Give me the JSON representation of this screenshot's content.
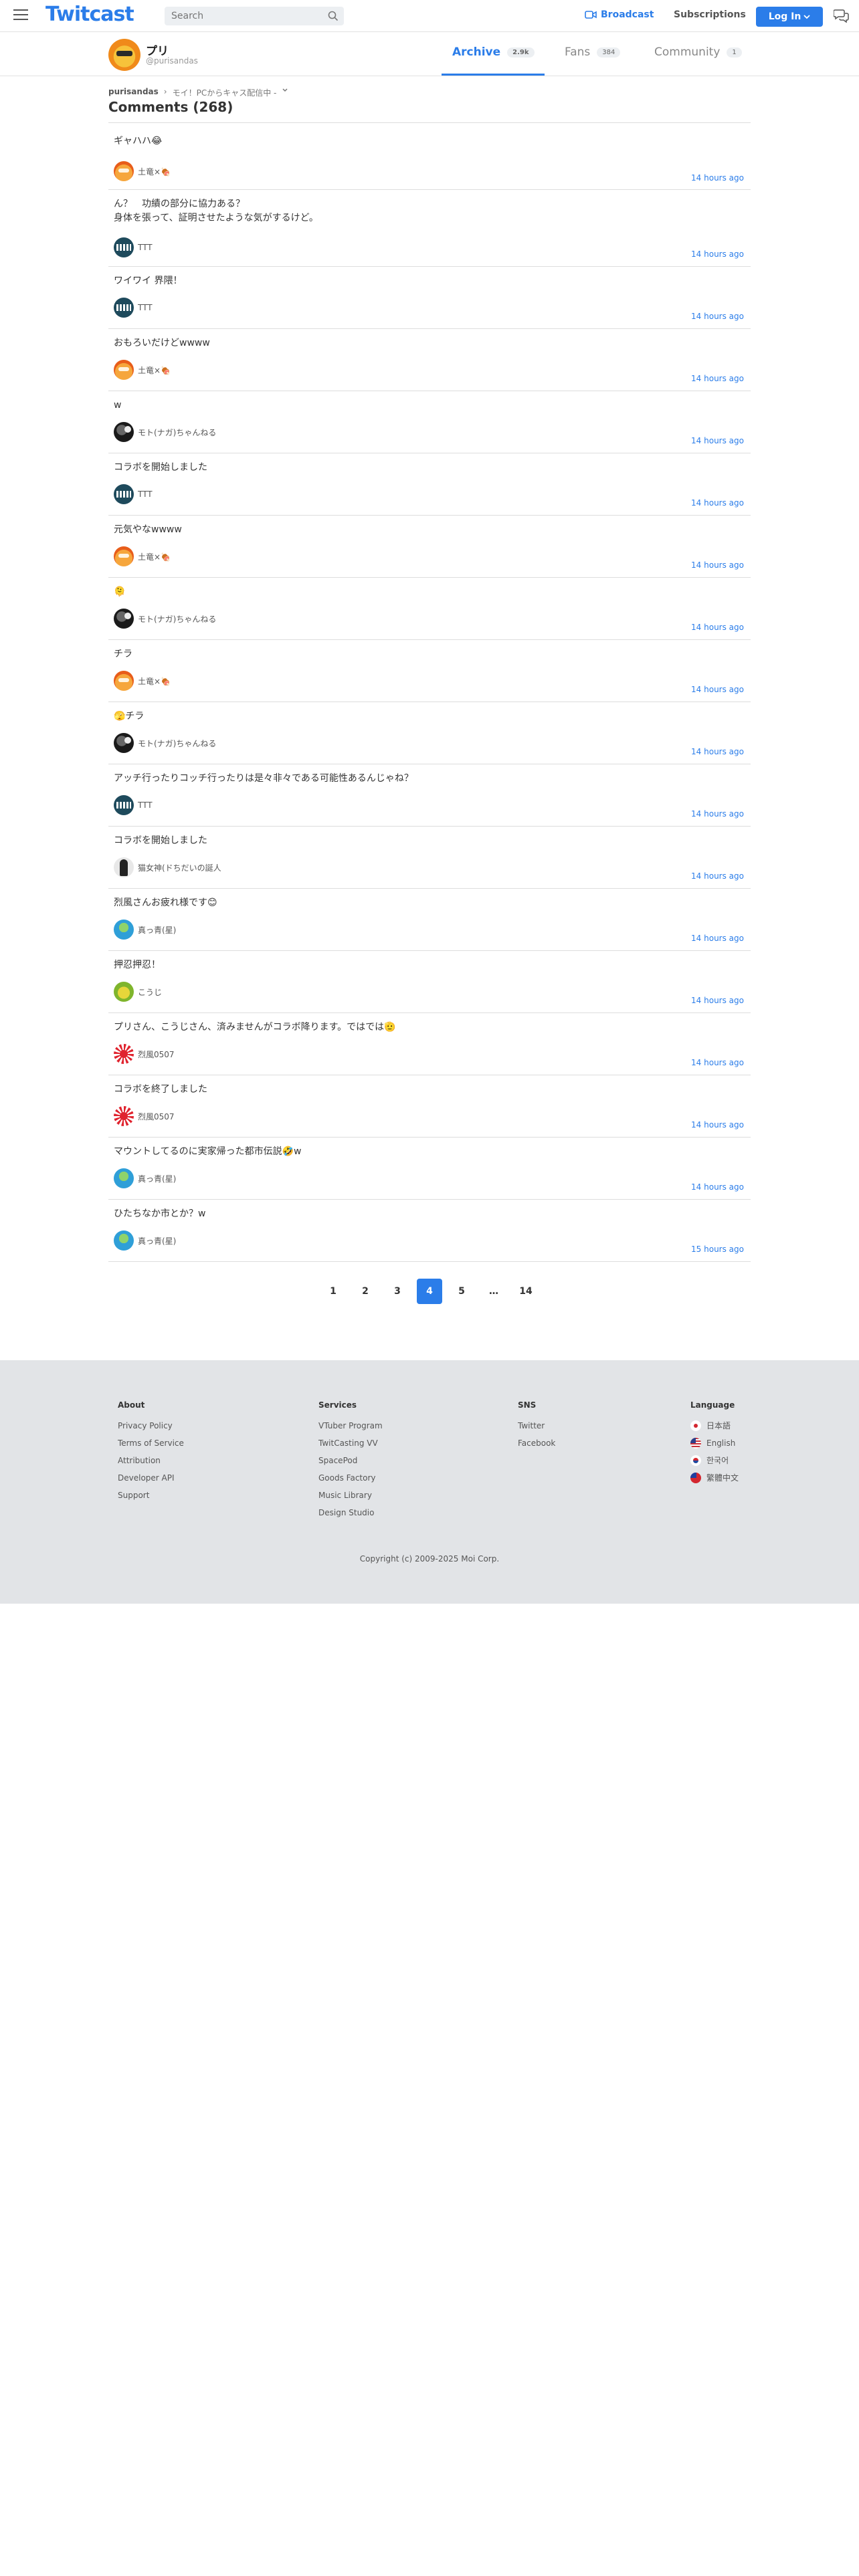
{
  "header": {
    "logo": "Twitcast",
    "search_placeholder": "Search",
    "broadcast_label": "Broadcast",
    "subscriptions_label": "Subscriptions",
    "login_label": "Log In"
  },
  "profile": {
    "name": "プリ",
    "handle": "@purisandas",
    "tabs": [
      {
        "label": "Archive",
        "count": "2.9k"
      },
      {
        "label": "Fans",
        "count": "384"
      },
      {
        "label": "Community",
        "count": "1"
      }
    ]
  },
  "breadcrumb": {
    "user": "purisandas",
    "separator": "›",
    "movie": "モイ！PCからキャス配信中 -"
  },
  "page_title": "Comments (268)",
  "comments": [
    {
      "message": "ギャハハ😂",
      "author": "土竜×🍖",
      "time": "14 hours ago"
    },
    {
      "message": "ん？　功績の部分に協力ある？\n身体を張って、証明させたような気がするけど。",
      "author": "TTT",
      "time": "14 hours ago"
    },
    {
      "message": "ワイワイ 界隈！",
      "author": "TTT",
      "time": "14 hours ago"
    },
    {
      "message": "おもろいだけどwwww",
      "author": "土竜×🍖",
      "time": "14 hours ago"
    },
    {
      "message": "w",
      "author": "モト(ナガ)ちゃんねる",
      "time": "14 hours ago"
    },
    {
      "message": "コラボを開始しました",
      "author": "TTT",
      "time": "14 hours ago"
    },
    {
      "message": "元気やなwwww",
      "author": "土竜×🍖",
      "time": "14 hours ago"
    },
    {
      "message": "🫠",
      "author": "モト(ナガ)ちゃんねる",
      "time": "14 hours ago"
    },
    {
      "message": "チラ",
      "author": "土竜×🍖",
      "time": "14 hours ago"
    },
    {
      "message": "🫣チラ",
      "author": "モト(ナガ)ちゃんねる",
      "time": "14 hours ago"
    },
    {
      "message": "アッチ行ったりコッチ行ったりは是々非々である可能性あるんじゃね？",
      "author": "TTT",
      "time": "14 hours ago"
    },
    {
      "message": "コラボを開始しました",
      "author": "猫女神(ドちだいの誕人",
      "time": "14 hours ago"
    },
    {
      "message": "烈風さんお疲れ様です😊",
      "author": "真っ青(星)",
      "time": "14 hours ago"
    },
    {
      "message": "押忍押忍！",
      "author": "こうじ",
      "time": "14 hours ago"
    },
    {
      "message": "プリさん、こうじさん、済みませんがコラボ降ります。ではでは🫡",
      "author": "烈風0507",
      "time": "14 hours ago"
    },
    {
      "message": "コラボを終了しました",
      "author": "烈風0507",
      "time": "14 hours ago"
    },
    {
      "message": "マウントしてるのに実家帰った都市伝説🤣w",
      "author": "真っ青(星)",
      "time": "14 hours ago"
    },
    {
      "message": "ひたちなか市とか？w",
      "author": "真っ青(星)",
      "time": "15 hours ago"
    }
  ],
  "pagination": {
    "pages": [
      "1",
      "2",
      "3",
      "4",
      "5",
      "…",
      "14"
    ],
    "current": "4"
  },
  "footer": {
    "about": {
      "title": "About",
      "links": [
        "Privacy Policy",
        "Terms of Service",
        "Attribution",
        "Developer API",
        "Support"
      ]
    },
    "services": {
      "title": "Services",
      "links": [
        "VTuber Program",
        "TwitCasting VV",
        "SpacePod",
        "Goods Factory",
        "Music Library",
        "Design Studio"
      ]
    },
    "sns": {
      "title": "SNS",
      "links": [
        "Twitter",
        "Facebook"
      ]
    },
    "language": {
      "title": "Language",
      "links": [
        "日本語",
        "English",
        "한국어",
        "繁體中文"
      ]
    },
    "copyright": "Copyright (c) 2009-2025 Moi Corp."
  },
  "colors": {
    "accent": "#2b7de9",
    "footer_bg": "#e2e4e7"
  }
}
